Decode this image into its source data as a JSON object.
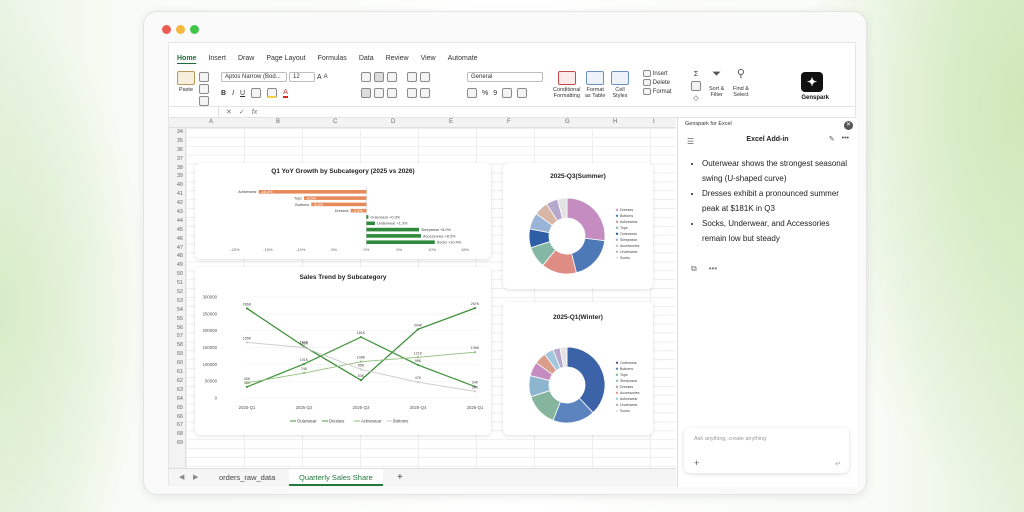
{
  "ribbon_tabs": [
    "Home",
    "Insert",
    "Draw",
    "Page Layout",
    "Formulas",
    "Data",
    "Review",
    "View",
    "Automate"
  ],
  "ribbon": {
    "paste": "Paste",
    "font_name": "Aptos Narrow (Bod...",
    "font_size": "12",
    "number_format": "General",
    "conditional_formatting": [
      "Conditional",
      "Formatting"
    ],
    "format_as_table": [
      "Format",
      "as Table"
    ],
    "cell_styles": [
      "Cell",
      "Styles"
    ],
    "insert": "Insert",
    "delete": "Delete",
    "format": "Format",
    "sort_filter": [
      "Sort &",
      "Filter"
    ],
    "find_select": [
      "Find &",
      "Select"
    ],
    "genspark": "Genspark",
    "bold": "B",
    "italic": "I",
    "underline": "U"
  },
  "formula_bar": {
    "fx": "fx"
  },
  "columns": [
    "A",
    "B",
    "C",
    "D",
    "E",
    "F",
    "G",
    "H",
    "I"
  ],
  "rows": [
    "34",
    "35",
    "36",
    "37",
    "38",
    "39",
    "40",
    "41",
    "42",
    "43",
    "44",
    "45",
    "46",
    "47",
    "48",
    "49",
    "50",
    "51",
    "52",
    "53",
    "54",
    "55",
    "56",
    "57",
    "58",
    "59",
    "60",
    "61",
    "62",
    "63",
    "64",
    "65",
    "66",
    "67",
    "68",
    "69"
  ],
  "sheet_tabs": [
    "orders_raw_data",
    "Quarterly Sales Share"
  ],
  "add_sheet": "+",
  "chart_data": [
    {
      "type": "bar",
      "title": "Q1 YoY Growth by Subcategory (2025 vs 2026)",
      "categories": [
        "Activewear",
        "Tops",
        "Bottoms",
        "Dresses",
        "Outerwear",
        "Underwear",
        "Sleepwear",
        "Accessories",
        "Socks"
      ],
      "values": [
        -16.4,
        -9.5,
        -8.4,
        -2.4,
        0.3,
        1.3,
        8.0,
        8.3,
        10.4
      ],
      "labels": [
        "-16.4%",
        "-9.5%",
        "-8.4%",
        "-2.4%",
        "+0.3%",
        "+1.3%",
        "+8.0%",
        "+8.3%",
        "+10.4%"
      ],
      "xticks": [
        "-20%",
        "-15%",
        "-10%",
        "-5%",
        "0%",
        "5%",
        "10%",
        "15%"
      ],
      "xlim": [
        -20,
        15
      ],
      "colors": {
        "negative": "#e8895a",
        "positive": "#2f8a3e"
      }
    },
    {
      "type": "line",
      "title": "Sales Trend by Subcategory",
      "categories": [
        "2025-Q1",
        "2025-Q2",
        "2025-Q3",
        "2025-Q4",
        "2026-Q1"
      ],
      "yticks": [
        "300000",
        "250000",
        "200000",
        "150000",
        "100000",
        "50000",
        "0"
      ],
      "ylim": [
        0,
        300000
      ],
      "series": [
        {
          "name": "Outerwear",
          "values": [
            266000,
            153000,
            53000,
            204000,
            267000
          ],
          "labels": [
            "266K",
            "150K",
            "53K",
            "204K",
            "267K"
          ],
          "color": "#3f8f3a"
        },
        {
          "name": "Dresses",
          "values": [
            33000,
            101000,
            181000,
            98000,
            34000
          ],
          "labels": [
            "33K",
            "101K",
            "181K",
            "98K",
            "34K"
          ],
          "color": "#4a9a44"
        },
        {
          "name": "Activewear",
          "values": [
            45000,
            74000,
            108000,
            121000,
            136000
          ],
          "labels": [
            "45K",
            "74K",
            "108K",
            "121K",
            "136K"
          ],
          "color": "#8fc07a"
        },
        {
          "name": "Bottoms",
          "values": [
            165000,
            150000,
            85000,
            47000,
            20000
          ],
          "labels": [
            "165K",
            "150K",
            "85K",
            "47K",
            "20K"
          ],
          "color": "#c9c9c9"
        }
      ]
    },
    {
      "type": "pie",
      "title": "2025-Q3(Summer)",
      "categories": [
        "Dresses",
        "Bottoms",
        "Activewear",
        "Tops",
        "Outerwear",
        "Sleepwear",
        "Accessories",
        "Underwear",
        "Socks"
      ],
      "values": [
        27,
        19,
        15,
        9,
        8,
        7,
        6,
        5,
        4
      ],
      "colors": [
        "#c48cc0",
        "#4e79b7",
        "#de8c84",
        "#84b8a4",
        "#2e5ea6",
        "#9ab3d8",
        "#d8b6a6",
        "#b6a7cc",
        "#e3e3e3"
      ]
    },
    {
      "type": "pie",
      "title": "2025-Q1(Winter)",
      "categories": [
        "Outerwear",
        "Bottoms",
        "Tops",
        "Sleepwear",
        "Dresses",
        "Accessories",
        "Activewear",
        "Underwear",
        "Socks"
      ],
      "values": [
        38,
        18,
        14,
        9,
        6,
        5,
        4,
        3,
        3
      ],
      "colors": [
        "#3c62a8",
        "#5b84be",
        "#86b59e",
        "#8db5cf",
        "#c48cc0",
        "#d99d8c",
        "#a2c6dc",
        "#b6a7cc",
        "#e3e3e3"
      ]
    }
  ],
  "panel": {
    "app_name": "Genspark for Excel",
    "title": "Excel Add-in",
    "bullets": [
      "Outerwear shows the strongest seasonal swing (U-shaped curve)",
      "Dresses exhibit a pronounced summer peak at $181K in Q3",
      "Socks, Underwear, and Accessories remain low but steady"
    ],
    "chat_placeholder": "Ask anything, create anything",
    "plus": "+"
  }
}
